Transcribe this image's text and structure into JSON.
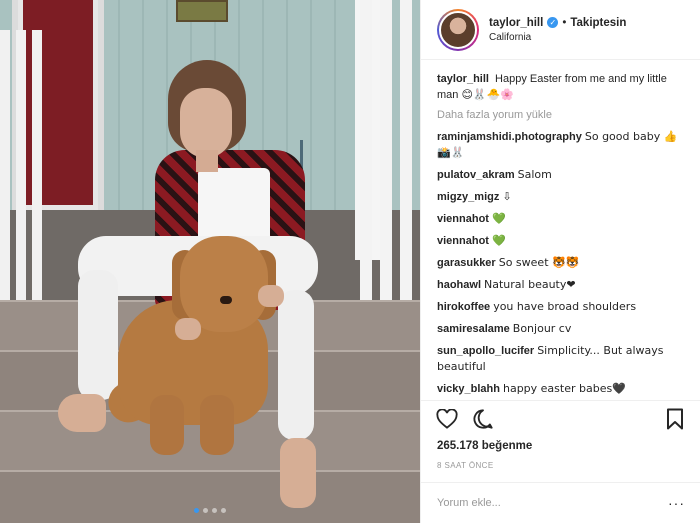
{
  "post": {
    "username": "taylor_hill",
    "follow_label": "Takiptesin",
    "separator": "•",
    "location": "California",
    "verified_glyph": "✓"
  },
  "caption": {
    "username": "taylor_hill",
    "text": "Happy Easter from me and my little man",
    "emojis": "😊🐰🐣🌸"
  },
  "load_more": "Daha fazla yorum yükle",
  "comments": [
    {
      "username": "raminjamshidi.photography",
      "text": "So good baby 👍📸🐰"
    },
    {
      "username": "pulatov_akram",
      "text": "Salom"
    },
    {
      "username": "migzy_migz",
      "text": "⇩"
    },
    {
      "username": "viennahot",
      "text": "💚"
    },
    {
      "username": "viennahot",
      "text": "💚"
    },
    {
      "username": "garasukker",
      "text": "So sweet 🐯🐯"
    },
    {
      "username": "haohawl",
      "text": "Natural beauty❤"
    },
    {
      "username": "hirokoffee",
      "text": "you have broad shoulders"
    },
    {
      "username": "samiresalame",
      "text": "Bonjour cv"
    },
    {
      "username": "sun_apollo_lucifer",
      "text": "Simplicity... But always beautiful"
    },
    {
      "username": "vicky_blahh",
      "text": "happy easter babes🖤"
    }
  ],
  "actions": {
    "icons": [
      "heart-icon",
      "comment-icon",
      "bookmark-icon"
    ]
  },
  "likes": "265.178 beğenme",
  "time": "8 SAAT ÖNCE",
  "comment_box": {
    "placeholder": "Yorum ekle...",
    "more": "···"
  },
  "carousel": {
    "count": 4,
    "active_index": 0
  },
  "colors": {
    "accent": "#3897f0",
    "text": "#262626",
    "muted": "#999999"
  }
}
